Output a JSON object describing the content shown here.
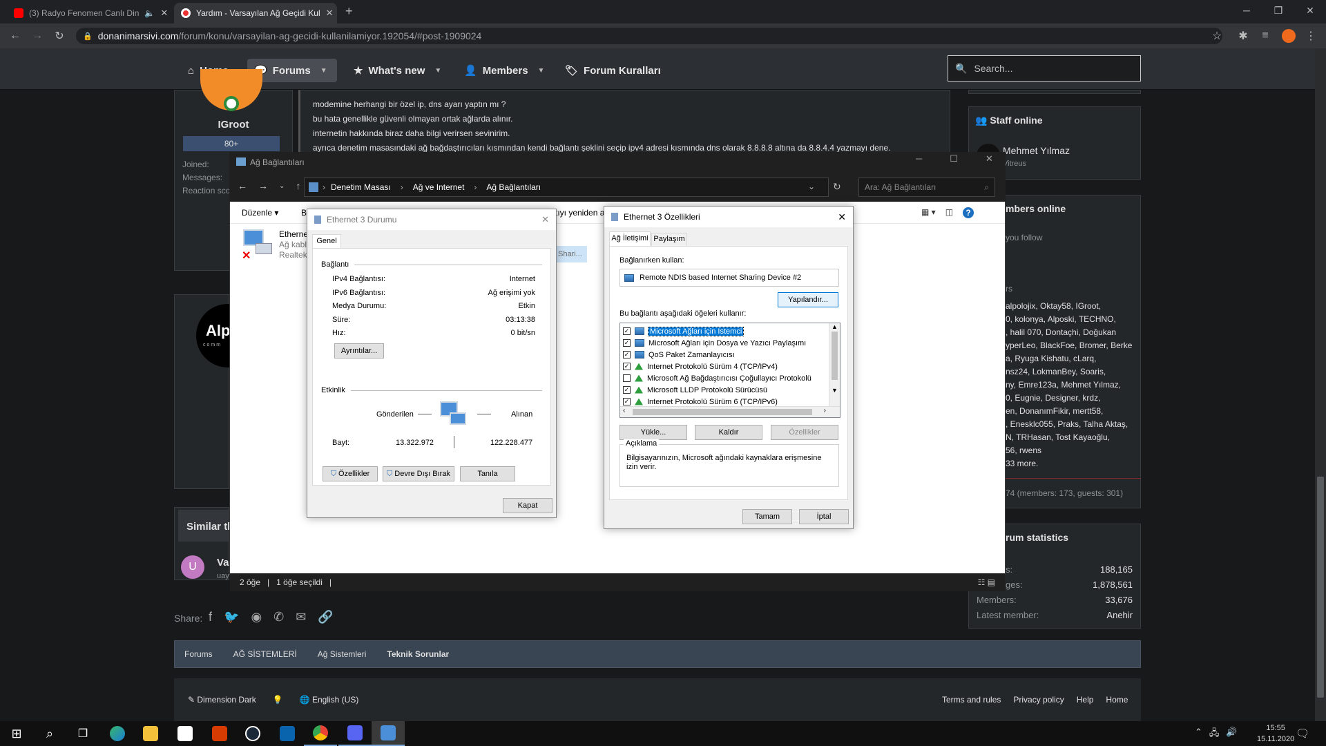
{
  "browser": {
    "tabs": [
      {
        "title": "(3) Radyo Fenomen Canlı Din",
        "active": false
      },
      {
        "title": "Yardım - Varsayılan Ağ Geçidi Kul",
        "active": true
      }
    ],
    "new_tab": "+",
    "url_host": "donanimarsivi.com",
    "url_path": "/forum/konu/varsayilan-ag-gecidi-kullanilamiyor.192054/#post-1909024"
  },
  "site": {
    "nav": [
      {
        "label": "Home"
      },
      {
        "label": "Forums"
      },
      {
        "label": "What's new"
      },
      {
        "label": "Members"
      },
      {
        "label": "Forum Kuralları"
      }
    ],
    "search_placeholder": "Search..."
  },
  "post": {
    "username": "IGroot",
    "badge": "80+",
    "meta": [
      "Joined:",
      "Messages:",
      "Reaction sco"
    ],
    "lines": [
      "modemine herhangi bir özel ip, dns ayarı yaptın mı ?",
      "bu hata genellikle güvenli olmayan ortak ağlarda alınır.",
      "internetin hakkında biraz daha bilgi verirsen sevinirim.",
      "ayrıca denetim masasındaki ağ bağdaştırıcıları kısmından kendi bağlantı şeklini seçip ipv4 adresi kısmında dns olarak 8.8.8.8 altına da 8.8.4.4 yazmayı dene."
    ],
    "ad_logo": "Alp",
    "ad_sub": "comm",
    "similar": "Similar th",
    "similar_user_initial": "U",
    "similar_title": "Va",
    "similar_meta": "uay"
  },
  "share": {
    "label": "Share:"
  },
  "breadcrumb": [
    "Forums",
    "AĞ SİSTEMLERİ",
    "Ağ Sistemleri",
    "Teknik Sorunlar"
  ],
  "footer": {
    "left": [
      "Dimension Dark",
      "English (US)"
    ],
    "right": [
      "Terms and rules",
      "Privacy policy",
      "Help",
      "Home"
    ]
  },
  "sidebar": {
    "staff_title": "Staff online",
    "staff_name": "Mehmet Yılmaz",
    "staff_sub": "Vitreus",
    "members_title": "mbers online",
    "members_follow": "you follow",
    "members_list_head": "rs",
    "members_lines": [
      "alpolojix, Oktay58, IGroot,",
      "0, kolonya, Alposki, TECHNO,",
      ", halil 070, Dontaçhi, Doğukan",
      "yperLeo, BlackFoe, Bromer, Berke",
      "a, Ryuga Kishatu, cLarq,",
      "nsz24, LokmanBey, Soaris,",
      "ny, Emre123a, Mehmet Yılmaz,",
      "0, Eugnie, Designer, krdz,",
      "en, DonanımFikir, mertt58,",
      ", Enesklc055, Praks, Talha Aktaş,",
      "N, TRHasan, Tost Kayaoğlu,",
      "56, rwens",
      "33 more."
    ],
    "members_total": "74 (members: 173, guests: 301)",
    "stats_title": "rum statistics",
    "stats": [
      {
        "label": "s:",
        "value": "188,165"
      },
      {
        "label": "ges:",
        "value": "1,878,561"
      },
      {
        "label": "Members:",
        "value": "33,676"
      },
      {
        "label": "Latest member:",
        "value": "Anehir"
      }
    ]
  },
  "explorer": {
    "title": "Ağ Bağlantıları",
    "crumbs": [
      "Denetim Masası",
      "Ağ ve Internet",
      "Ağ Bağlantıları"
    ],
    "search_placeholder": "Ara: Ağ Bağlantıları",
    "cmd_organize": "Düzenle",
    "cmd_b": "B",
    "cmd_rename": "tıyı yeniden a",
    "item_name": "Etherne",
    "item_status": "Ağ kabl",
    "item_device": "Realtek",
    "shared_item": "Shari...",
    "status_count": "2 öğe",
    "status_selected": "1 öğe seçildi"
  },
  "status_dialog": {
    "title": "Ethernet 3 Durumu",
    "tab": "Genel",
    "conn_title": "Bağlantı",
    "rows": [
      {
        "label": "IPv4 Bağlantısı:",
        "value": "Internet"
      },
      {
        "label": "IPv6 Bağlantısı:",
        "value": "Ağ erişimi yok"
      },
      {
        "label": "Medya Durumu:",
        "value": "Etkin"
      },
      {
        "label": "Süre:",
        "value": "03:13:38"
      },
      {
        "label": "Hız:",
        "value": "0 bit/sn"
      }
    ],
    "details_btn": "Ayrıntılar...",
    "activity_title": "Etkinlik",
    "sent": "Gönderilen",
    "received": "Alınan",
    "bytes_label": "Bayt:",
    "bytes_sent": "13.322.972",
    "bytes_recv": "122.228.477",
    "btn_props": "Özellikler",
    "btn_disable": "Devre Dışı Bırak",
    "btn_diagnose": "Tanıla",
    "btn_close": "Kapat"
  },
  "props_dialog": {
    "title": "Ethernet 3 Özellikleri",
    "tabs": [
      "Ağ İletişimi",
      "Paylaşım"
    ],
    "connect_using": "Bağlanırken kullan:",
    "adapter": "Remote NDIS based Internet Sharing Device #2",
    "configure_btn": "Yapılandır...",
    "items_label": "Bu bağlantı aşağıdaki öğeleri kullanır:",
    "items": [
      {
        "label": "Microsoft Ağları için İstemci",
        "checked": true,
        "icon": "net"
      },
      {
        "label": "Microsoft Ağları için Dosya ve Yazıcı Paylaşımı",
        "checked": true,
        "icon": "net"
      },
      {
        "label": "QoS Paket Zamanlayıcısı",
        "checked": true,
        "icon": "net"
      },
      {
        "label": "Internet Protokolü Sürüm 4 (TCP/IPv4)",
        "checked": true,
        "icon": "green"
      },
      {
        "label": "Microsoft Ağ Bağdaştırıcısı Çoğullayıcı Protokolü",
        "checked": false,
        "icon": "green"
      },
      {
        "label": "Microsoft LLDP Protokolü Sürücüsü",
        "checked": true,
        "icon": "green"
      },
      {
        "label": "Internet Protokolü Sürüm 6 (TCP/IPv6)",
        "checked": true,
        "icon": "green"
      }
    ],
    "install_btn": "Yükle...",
    "remove_btn": "Kaldır",
    "props_btn": "Özellikler",
    "desc_title": "Açıklama",
    "desc_text": "Bilgisayarınızın, Microsoft ağındaki kaynaklara erişmesine izin verir.",
    "ok_btn": "Tamam",
    "cancel_btn": "İptal"
  },
  "taskbar": {
    "time": "15:55",
    "date": "15.11.2020"
  },
  "colors": {
    "accent": "#0078d7",
    "brand_orange": "#f28c28",
    "youtube_red": "#ff0000"
  }
}
